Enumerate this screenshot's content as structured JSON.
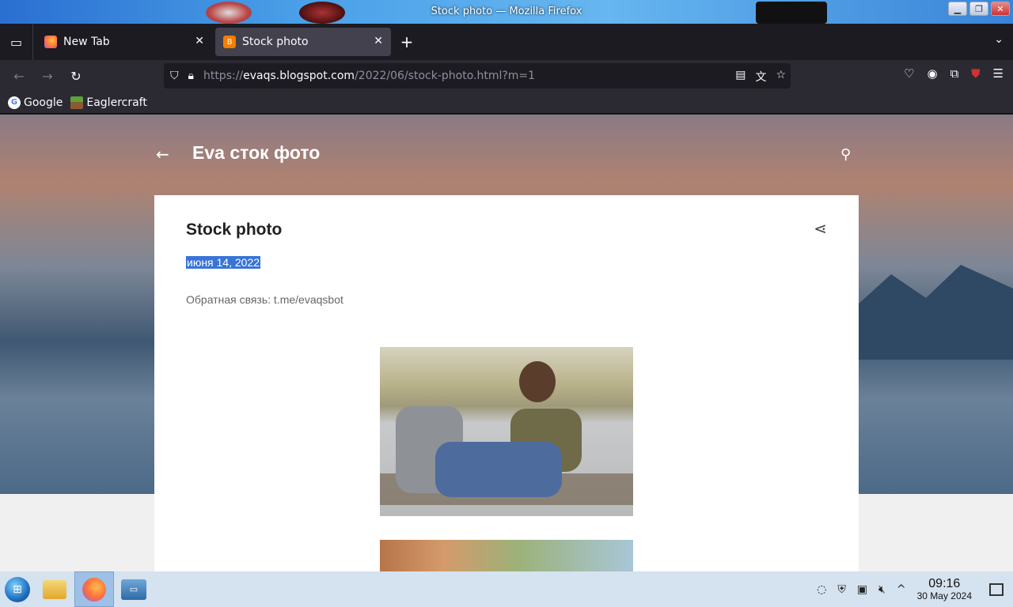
{
  "window": {
    "title": "Stock photo — Mozilla Firefox",
    "controls": {
      "minimize": "▁",
      "maximize": "❐",
      "close": "✕"
    }
  },
  "tabs": [
    {
      "label": "New Tab",
      "favicon": "firefox-icon",
      "close": "✕"
    },
    {
      "label": "Stock photo",
      "favicon": "blogger-icon",
      "close": "✕",
      "active": true
    }
  ],
  "tabstrip": {
    "new_tab": "+",
    "list_all": "▭",
    "overflow": "⌄"
  },
  "navbar": {
    "back": "←",
    "forward": "→",
    "reload": "↻",
    "url_prefix": "https://",
    "url_host": "evaqs.blogspot.com",
    "url_path": "/2022/06/stock-photo.html?m=1"
  },
  "bookmarks": [
    {
      "label": "Google",
      "icon": "google-icon"
    },
    {
      "label": "Eaglercraft",
      "icon": "grass-block-icon"
    }
  ],
  "blog": {
    "title": "Eva сток фото",
    "post_title": "Stock photo",
    "date": "июня 14, 2022",
    "feedback": "Обратная связь: t.me/evaqsbot"
  },
  "taskbar": {
    "time": "09:16",
    "date": "30 May 2024"
  },
  "colors": {
    "accent_selection": "#3874d8",
    "firefox_dark": "#1c1b22"
  }
}
